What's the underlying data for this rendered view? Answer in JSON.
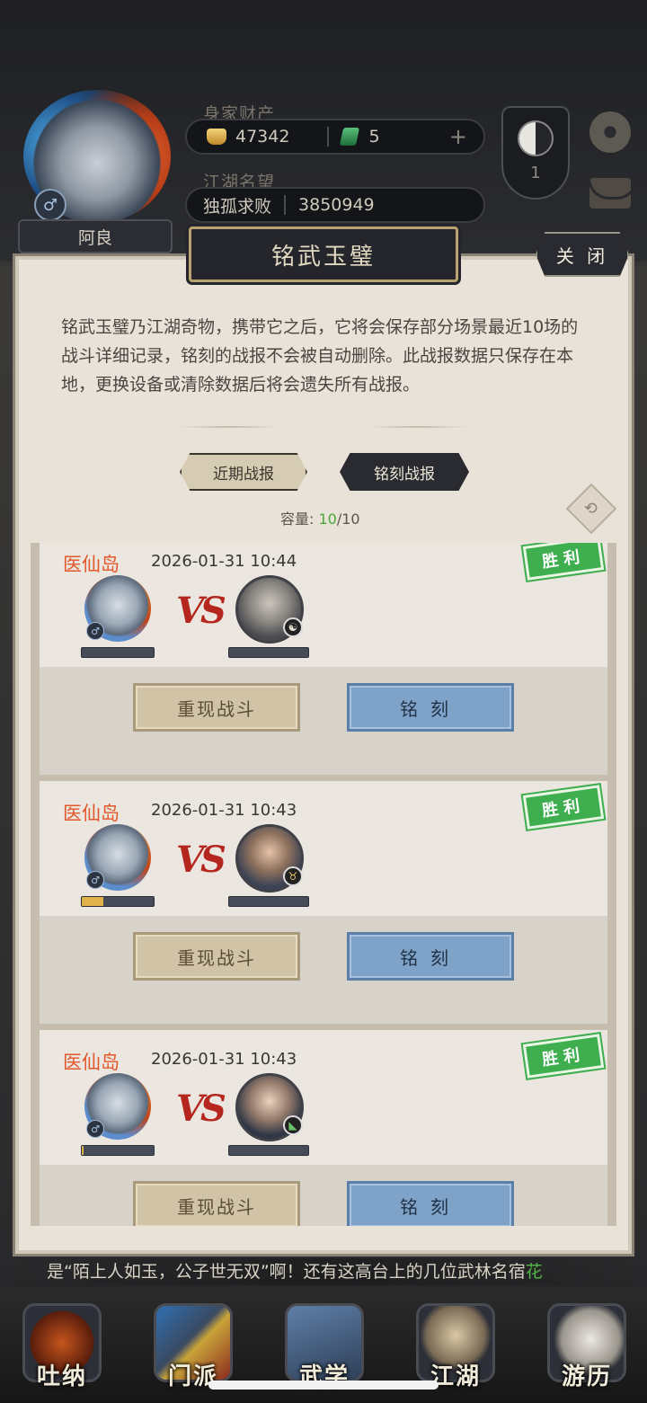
{
  "hud": {
    "player_name": "阿良",
    "gender_symbol": "♂",
    "wealth_label": "身家财产",
    "gold": "47342",
    "jade": "5",
    "plus": "+",
    "fame_label": "江湖名望",
    "fame_title": "独孤求败",
    "fame_value": "3850949",
    "badge_number": "1"
  },
  "panel": {
    "title": "铭武玉璧",
    "close_label": "关 闭",
    "description": "铭武玉璧乃江湖奇物，携带它之后，它将会保存部分场景最近10场的战斗详细记录，铭刻的战报不会被自动删除。此战报数据只保存在本地，更换设备或清除数据后将会遗失所有战报。",
    "tabs": [
      "近期战报",
      "铭刻战报"
    ],
    "capacity_label": "容量:",
    "capacity_used": "10",
    "capacity_total": "/10"
  },
  "battles": [
    {
      "location": "医仙岛",
      "time": "2026-01-31 10:44",
      "result": "胜利",
      "vs": "VS",
      "player_hp": 0.0,
      "replay_label": "重现战斗",
      "engrave_label": "铭刻",
      "enemy_badge": "☯"
    },
    {
      "location": "医仙岛",
      "time": "2026-01-31 10:43",
      "result": "胜利",
      "vs": "VS",
      "player_hp": 0.3,
      "replay_label": "重现战斗",
      "engrave_label": "铭刻",
      "enemy_badge": "♉"
    },
    {
      "location": "医仙岛",
      "time": "2026-01-31 10:43",
      "result": "胜利",
      "vs": "VS",
      "player_hp": 0.03,
      "replay_label": "重现战斗",
      "engrave_label": "铭刻",
      "enemy_badge": "◣"
    }
  ],
  "marquee": {
    "text": "是“陌上人如玉，公子世无双”啊！还有这高台上的几位武林名宿",
    "highlight": "花"
  },
  "nav": [
    "吐纳",
    "门派",
    "武学",
    "江湖",
    "游历"
  ]
}
